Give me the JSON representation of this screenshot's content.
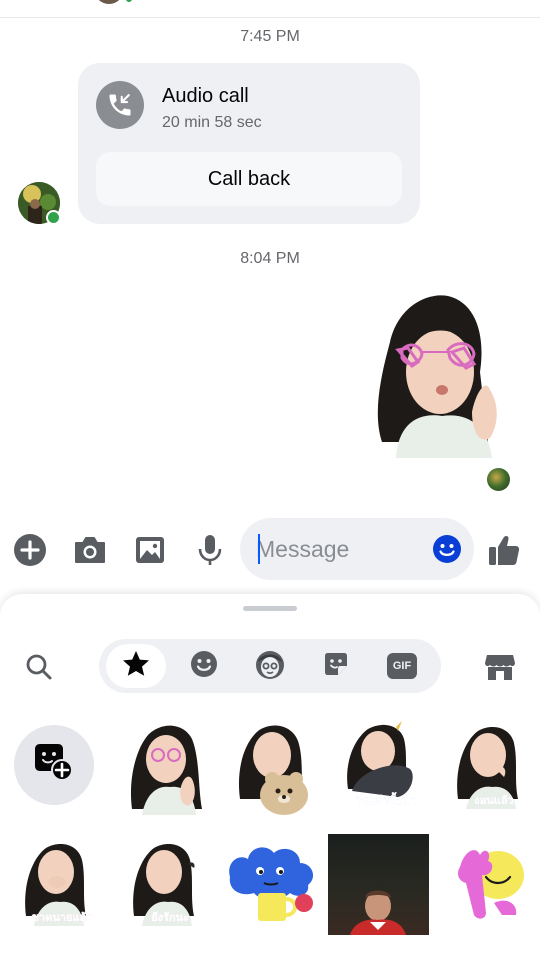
{
  "conversation": {
    "timestamps": [
      "7:45 PM",
      "8:04 PM"
    ],
    "call_card": {
      "title": "Audio call",
      "duration": "20 min 58 sec",
      "action_label": "Call back",
      "icon": "missed-call-icon"
    },
    "sent_sticker": {
      "icon": "sticker-heart-glasses-thumbs-up"
    }
  },
  "composer": {
    "placeholder": "Message",
    "icons": [
      "plus-icon",
      "camera-icon",
      "gallery-icon",
      "microphone-icon",
      "emoji-icon",
      "thumbs-up-icon"
    ]
  },
  "sticker_tray": {
    "tabs": [
      {
        "name": "favorites",
        "icon": "star-icon",
        "active": true
      },
      {
        "name": "emoji",
        "icon": "smiley-icon",
        "active": false
      },
      {
        "name": "avatar",
        "icon": "avatar-icon",
        "active": false
      },
      {
        "name": "stickers",
        "icon": "sticker-icon",
        "active": false
      },
      {
        "name": "gif",
        "icon": "gif-icon",
        "label": "GIF",
        "active": false
      }
    ],
    "sticker_captions": [
      "ถึงแล้วมั้ยน้า",
      "งอนแล้ว",
      "ขาดนายแล้ว",
      "ยังรักนะ"
    ],
    "colors": {
      "accent": "#0a58ff",
      "online": "#31a24c",
      "emoji_button": "#0a3fd6"
    }
  }
}
